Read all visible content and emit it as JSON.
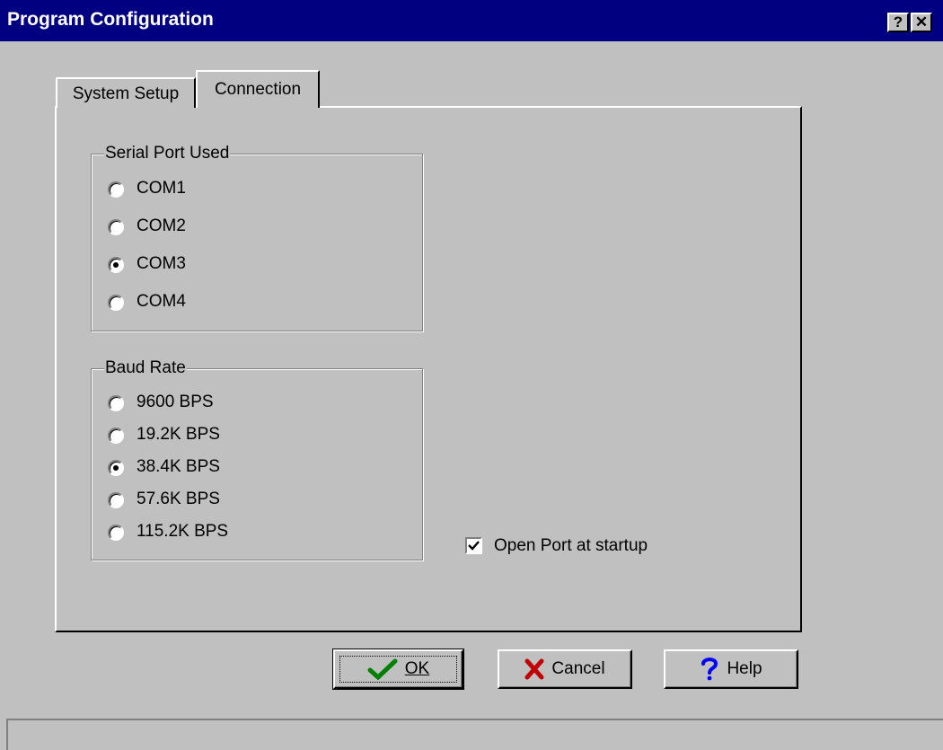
{
  "window": {
    "title": "Program Configuration",
    "help_button_glyph": "?",
    "close_button_glyph": "✕"
  },
  "tabs": [
    {
      "label": "System Setup",
      "selected": false
    },
    {
      "label": "Connection",
      "selected": true
    }
  ],
  "serial_port": {
    "label": "Serial Port Used",
    "options": [
      "COM1",
      "COM2",
      "COM3",
      "COM4"
    ],
    "selected": "COM3"
  },
  "baud_rate": {
    "label": "Baud Rate",
    "options": [
      "9600 BPS",
      "19.2K BPS",
      "38.4K BPS",
      "57.6K BPS",
      "115.2K BPS"
    ],
    "selected": "38.4K BPS"
  },
  "open_port": {
    "label": "Open Port at startup",
    "checked": true
  },
  "buttons": {
    "ok": {
      "label": "OK",
      "icon": "checkmark-icon",
      "icon_color": "#008000"
    },
    "cancel": {
      "label": "Cancel",
      "icon": "x-icon",
      "icon_color": "#c00000"
    },
    "help": {
      "label": "Help",
      "icon": "question-icon",
      "icon_color": "#0000ff"
    }
  },
  "status": {
    "text": ""
  },
  "colors": {
    "titlebar": "#000080",
    "face": "#c0c0c0"
  }
}
